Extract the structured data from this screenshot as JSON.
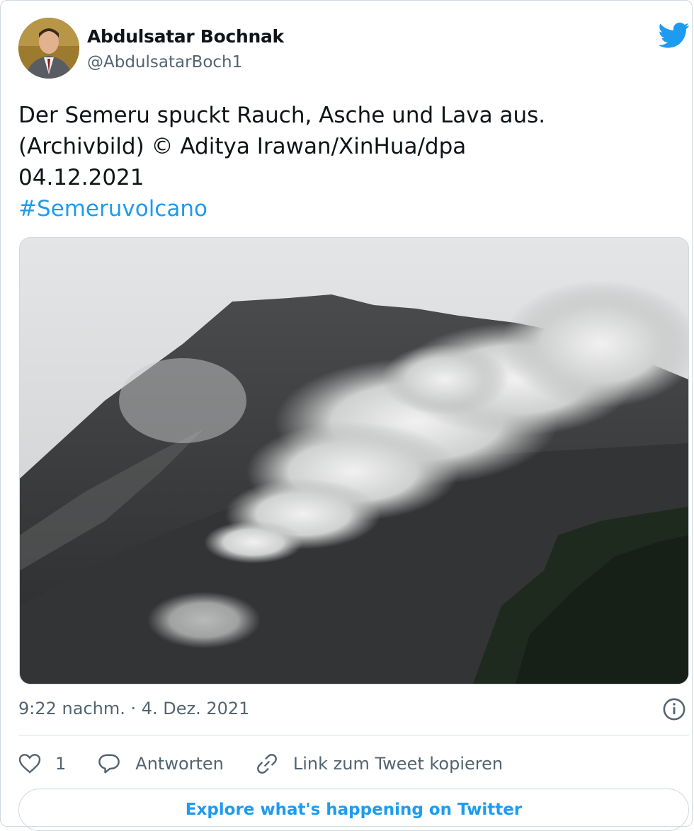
{
  "author": {
    "name": "Abdulsatar Bochnak",
    "handle": "@AbdulsatarBoch1",
    "avatar_icon": "user-avatar"
  },
  "brand": {
    "icon": "twitter-bird-icon",
    "color": "#1d9bf0"
  },
  "tweet": {
    "text": "Der Semeru spuckt Rauch, Asche und Lava aus.\n(Archivbild)  © Aditya Irawan/XinHua/dpa\n04.12.2021",
    "hashtag": "#Semeruvolcano",
    "image_description_icon": "volcano-photo"
  },
  "meta": {
    "timestamp": "9:22 nachm. · 4. Dez. 2021",
    "info_icon": "info-icon"
  },
  "actions": {
    "like_count": "1",
    "reply_label": "Antworten",
    "copy_link_label": "Link zum Tweet kopieren"
  },
  "footer": {
    "explore_label": "Explore what's happening on Twitter"
  }
}
